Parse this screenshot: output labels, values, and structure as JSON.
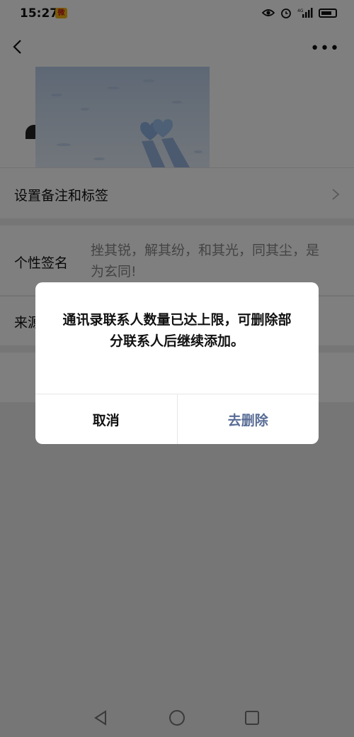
{
  "status_bar": {
    "time": "15:27",
    "notification_icon": "weibo-icon",
    "right_icons": [
      "eye-icon",
      "alarm-icon",
      "4g-signal-icon",
      "battery-charging-icon"
    ]
  },
  "nav": {
    "back_icon": "chevron-left-icon",
    "more_icon": "more-dots-icon"
  },
  "profile": {
    "photo": "snow-hearts-photo"
  },
  "rows": {
    "remark_label": "设置备注和标签",
    "signature_label": "个性签名",
    "signature_value": "挫其锐，解其纷，和其光，同其尘，是为玄同!",
    "source_label": "来源"
  },
  "dialog": {
    "message": "通讯录联系人数量已达上限，可删除部分联系人后继续添加。",
    "cancel_label": "取消",
    "confirm_label": "去删除"
  },
  "colors": {
    "accent": "#576b95",
    "overlay": "rgba(0,0,0,0.5)"
  },
  "system_nav": [
    "back-triangle-icon",
    "home-circle-icon",
    "recents-square-icon"
  ]
}
